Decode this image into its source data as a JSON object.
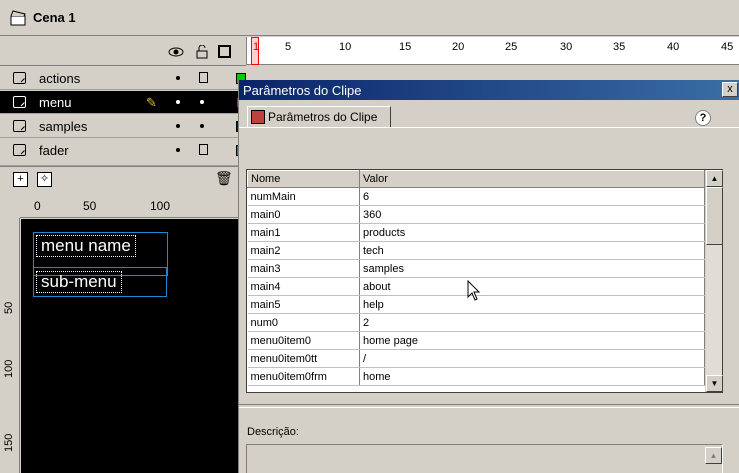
{
  "scene": {
    "title": "Cena 1"
  },
  "timeline": {
    "frame_numbers": [
      "1",
      "5",
      "10",
      "15",
      "20",
      "25",
      "30",
      "35",
      "40",
      "45"
    ]
  },
  "layers": [
    {
      "name": "actions",
      "color": "#00cc00",
      "selected": false
    },
    {
      "name": "menu",
      "color": "#0055ff",
      "selected": true
    },
    {
      "name": "samples",
      "color": "#0000ff",
      "selected": false
    },
    {
      "name": "fader",
      "color": "#ff3030",
      "selected": false
    }
  ],
  "stage": {
    "ruler_top": [
      "0",
      "50",
      "100"
    ],
    "ruler_left": [
      "50",
      "100",
      "150"
    ],
    "clips": [
      "menu name",
      "sub-menu"
    ]
  },
  "dialog": {
    "title": "Parâmetros do Clipe",
    "close_label": "x",
    "tab_label": "Parâmetros do Clipe",
    "help_label": "?",
    "table": {
      "headers": [
        "Nome",
        "Valor"
      ],
      "rows": [
        [
          "numMain",
          "6"
        ],
        [
          "main0",
          "360"
        ],
        [
          "main1",
          "products"
        ],
        [
          "main2",
          "tech"
        ],
        [
          "main3",
          "samples"
        ],
        [
          "main4",
          "about"
        ],
        [
          "main5",
          "help"
        ],
        [
          "num0",
          "2"
        ],
        [
          "menu0item0",
          "home page"
        ],
        [
          "menu0item0tt",
          "/"
        ],
        [
          "menu0item0frm",
          "home"
        ]
      ]
    },
    "description_label": "Descrição:"
  }
}
